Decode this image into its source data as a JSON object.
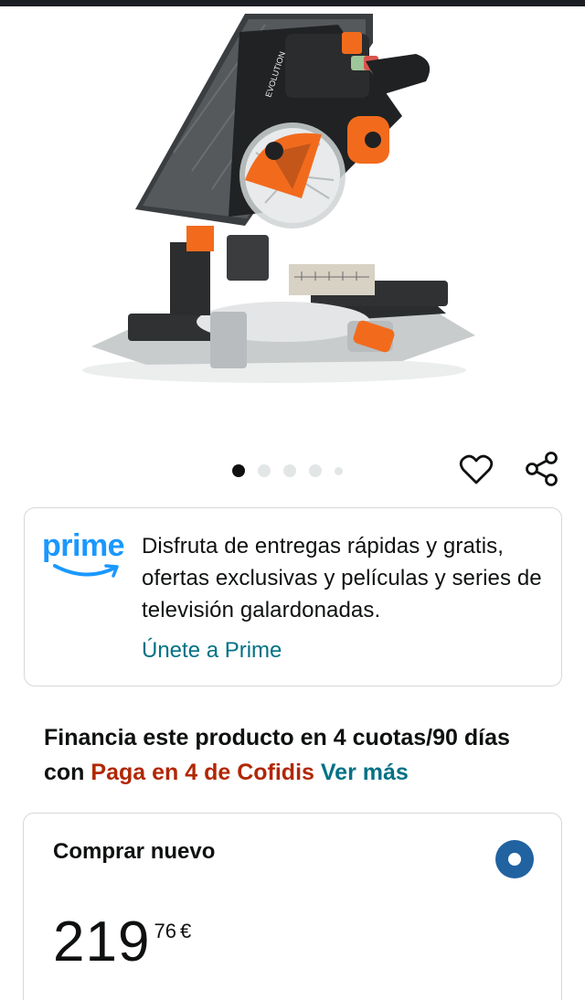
{
  "product": {
    "image_alt": "Ingletadora con mesa superior",
    "brand_print": "EVOLUTION"
  },
  "carousel": {
    "count": 5,
    "active_index": 0
  },
  "prime": {
    "logo_text": "prime",
    "description": "Disfruta de entregas rápidas y gratis, ofertas exclusivas y películas y series de televisión galardonadas.",
    "link_label": "Únete a Prime"
  },
  "financing": {
    "text": "Financia este producto en 4 cuotas/90 días con",
    "provider": "Paga en 4 de Cofidis",
    "more_label": "Ver más"
  },
  "buy_box": {
    "title": "Comprar nuevo",
    "price_whole": "219",
    "price_fraction": "76",
    "currency": "€"
  },
  "colors": {
    "prime_blue": "#1a98ff",
    "link_teal": "#007185",
    "provider_red": "#b12704",
    "radio_blue": "#2162a1",
    "accent_orange": "#f26b1d"
  }
}
